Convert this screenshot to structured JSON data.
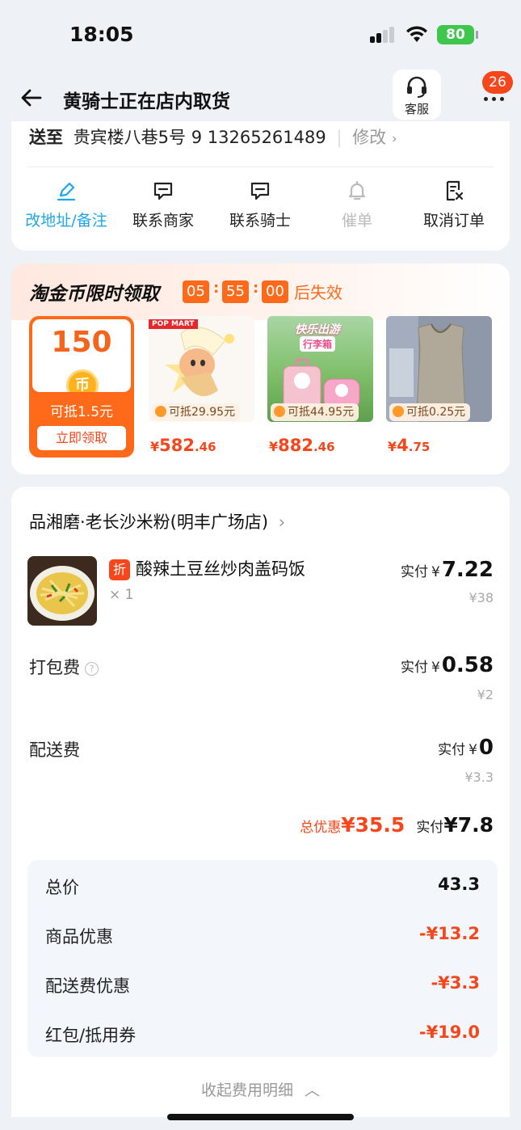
{
  "status_bar": {
    "time": "18:05",
    "battery": "80"
  },
  "nav": {
    "title": "黄骑士正在店内取货",
    "service_label": "客服",
    "notification_count": "26"
  },
  "address": {
    "label": "送至",
    "text": "贵宾楼八巷5号 9 13265261489",
    "modify": "修改"
  },
  "actions": [
    {
      "label": "改地址/备注",
      "icon": "edit-icon",
      "state": "active"
    },
    {
      "label": "联系商家",
      "icon": "chat-icon",
      "state": "normal"
    },
    {
      "label": "联系骑士",
      "icon": "chat-icon",
      "state": "normal"
    },
    {
      "label": "催单",
      "icon": "bell-icon",
      "state": "disabled"
    },
    {
      "label": "取消订单",
      "icon": "cancel-order-icon",
      "state": "normal"
    }
  ],
  "coin_promo": {
    "title": "淘金币限时领取",
    "timer": [
      "05",
      "55",
      "00"
    ],
    "expire_text": "后失效",
    "claim": {
      "amount": "150",
      "coin_symbol": "币",
      "desc": "可抵1.5元",
      "button": "立即领取"
    },
    "products": [
      {
        "tag": "可抵29.95元",
        "yen": "¥",
        "price_int": "582",
        "price_dec": ".46",
        "brand_text": "POP MART"
      },
      {
        "tag": "可抵44.95元",
        "yen": "¥",
        "price_int": "882",
        "price_dec": ".46",
        "banner_text": "快乐出游",
        "banner_text2": "行李箱"
      },
      {
        "tag": "可抵0.25元",
        "yen": "¥",
        "price_int": "4",
        "price_dec": ".75"
      }
    ]
  },
  "order": {
    "shop_name": "品湘磨·老长沙米粉(明丰广场店)",
    "item": {
      "badge": "折",
      "name": "酸辣土豆丝炒肉盖码饭",
      "qty": "× 1",
      "pay_label": "实付",
      "pay_yen": "¥",
      "pay_value": "7.22",
      "original": "¥38"
    },
    "packing": {
      "label": "打包费",
      "pay_label": "实付",
      "pay_yen": "¥",
      "pay_value": "0.58",
      "original": "¥2"
    },
    "delivery": {
      "label": "配送费",
      "pay_label": "实付",
      "pay_yen": "¥",
      "pay_value": "0",
      "original": "¥3.3"
    },
    "summary": {
      "discount_label": "总优惠",
      "discount_value": "¥35.5",
      "pay_label": "实付",
      "pay_value": "¥7.8"
    },
    "details": [
      {
        "label": "总价",
        "value": "43.3",
        "color": "black"
      },
      {
        "label": "商品优惠",
        "value": "-¥13.2",
        "color": "red"
      },
      {
        "label": "配送费优惠",
        "value": "-¥3.3",
        "color": "red"
      },
      {
        "label": "红包/抵用券",
        "value": "-¥19.0",
        "color": "red"
      }
    ],
    "collapse_text": "收起费用明细"
  },
  "colors": {
    "accent": "#ff6a1a",
    "price_red": "#f5461c",
    "active_blue": "#1ea7e8",
    "battery_green": "#3ec64d"
  }
}
